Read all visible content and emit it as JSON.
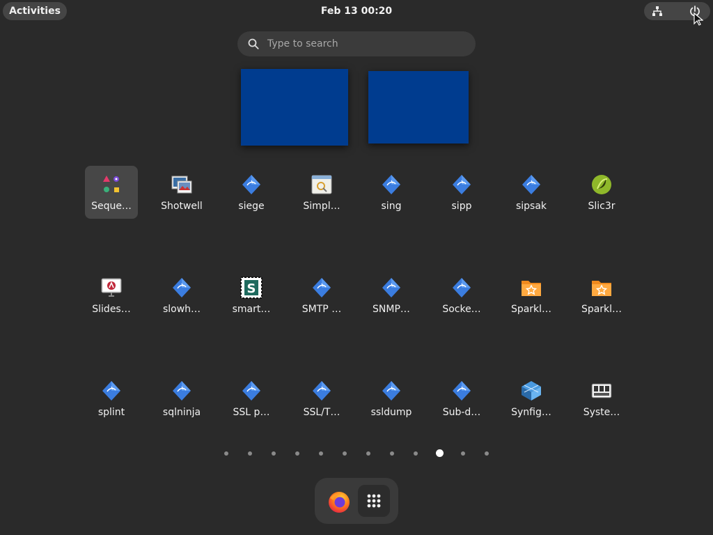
{
  "topbar": {
    "activities_label": "Activities",
    "clock": "Feb 13  00:20",
    "status_icons": [
      "network-wired-icon",
      "power-icon"
    ]
  },
  "search": {
    "placeholder": "Type to search"
  },
  "apps": [
    {
      "label": "Seque…",
      "icon": "sequeler-icon",
      "selected": true
    },
    {
      "label": "Shotwell",
      "icon": "shotwell-icon"
    },
    {
      "label": "siege",
      "icon": "kali-app-icon"
    },
    {
      "label": "Simpl…",
      "icon": "simple-scan-icon"
    },
    {
      "label": "sing",
      "icon": "kali-app-icon"
    },
    {
      "label": "sipp",
      "icon": "kali-app-icon"
    },
    {
      "label": "sipsak",
      "icon": "kali-app-icon"
    },
    {
      "label": "Slic3r",
      "icon": "slic3r-icon"
    },
    {
      "label": "Slides…",
      "icon": "slides-icon"
    },
    {
      "label": "slowh…",
      "icon": "kali-app-icon"
    },
    {
      "label": "smart…",
      "icon": "smartctl-icon"
    },
    {
      "label": "SMTP …",
      "icon": "kali-app-icon"
    },
    {
      "label": "SNMP…",
      "icon": "kali-app-icon"
    },
    {
      "label": "Socke…",
      "icon": "kali-app-icon"
    },
    {
      "label": "Sparkl…",
      "icon": "sparkleshare-folder-icon"
    },
    {
      "label": "Sparkl…",
      "icon": "sparkleshare-folder-icon"
    },
    {
      "label": "splint",
      "icon": "kali-app-icon"
    },
    {
      "label": "sqlninja",
      "icon": "kali-app-icon"
    },
    {
      "label": "SSL p…",
      "icon": "kali-app-icon"
    },
    {
      "label": "SSL/T…",
      "icon": "kali-app-icon"
    },
    {
      "label": "ssldump",
      "icon": "kali-app-icon"
    },
    {
      "label": "Sub-d…",
      "icon": "kali-app-icon"
    },
    {
      "label": "Synfig…",
      "icon": "synfig-icon"
    },
    {
      "label": "Syste…",
      "icon": "system-profiler-icon"
    }
  ],
  "pagination": {
    "count": 12,
    "active_index": 9
  },
  "dash": {
    "items": [
      "firefox-icon",
      "show-apps-grid-icon"
    ]
  },
  "colors": {
    "background": "#2a2a2a",
    "workspace": "#003c8f",
    "accent_icon": "#3b7de0"
  }
}
